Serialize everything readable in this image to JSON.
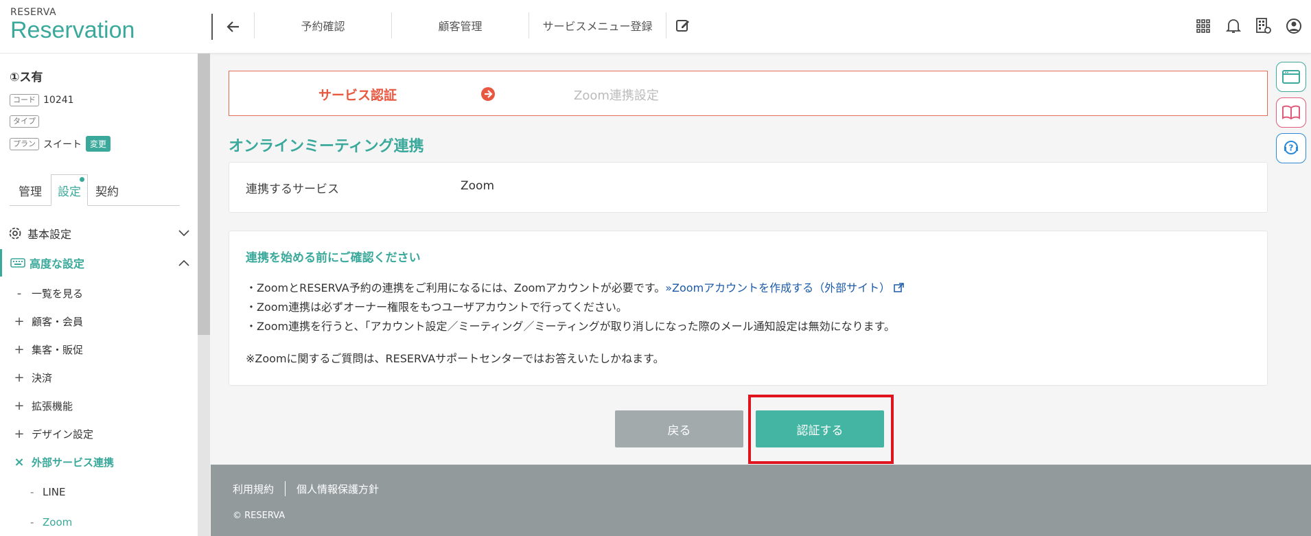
{
  "header": {
    "logo_small": "RESERVA",
    "logo_big": "Reservation",
    "nav": [
      "予約確認",
      "顧客管理",
      "サービスメニュー登録"
    ]
  },
  "sidebar": {
    "shop_name": "①ス有",
    "code_tag": "コード",
    "code_value": "10241",
    "type_tag": "タイプ",
    "plan_tag": "プラン",
    "plan_value": "スイート",
    "plan_change": "変更",
    "tabs": [
      "管理",
      "設定",
      "契約"
    ],
    "menu": [
      {
        "label": "基本設定"
      },
      {
        "label": "高度な設定"
      }
    ],
    "submenu": [
      {
        "sym": "-",
        "label": "一覧を見る"
      },
      {
        "sym": "+",
        "label": "顧客・会員"
      },
      {
        "sym": "+",
        "label": "集客・販促"
      },
      {
        "sym": "+",
        "label": "決済"
      },
      {
        "sym": "+",
        "label": "拡張機能"
      },
      {
        "sym": "+",
        "label": "デザイン設定"
      },
      {
        "sym": "×",
        "label": "外部サービス連携"
      }
    ],
    "subsub": [
      {
        "sym": "-",
        "label": "LINE"
      },
      {
        "sym": "-",
        "label": "Zoom"
      }
    ]
  },
  "steps": {
    "step1": "サービス認証",
    "step2": "Zoom連携設定"
  },
  "main": {
    "title": "オンラインミーティング連携",
    "service_key": "連携するサービス",
    "service_value": "Zoom",
    "notice_heading": "連携を始める前にご確認ください",
    "line1_text": "・ZoomとRESERVA予約の連携をご利用になるには、Zoomアカウントが必要です。",
    "line1_link": "»Zoomアカウントを作成する（外部サイト）",
    "line2": "・Zoom連携は必ずオーナー権限をもつユーザアカウントで行ってください。",
    "line3": "・Zoom連携を行うと、「アカウント設定／ミーティング／ミーティングが取り消しになった際のメール通知設定は無効になります。",
    "line4": "※Zoomに関するご質問は、RESERVAサポートセンターではお答えいたしかねます。",
    "back_button": "戻る",
    "auth_button": "認証する"
  },
  "footer": {
    "terms": "利用規約",
    "privacy": "個人情報保護方針",
    "copyright": "© RESERVA"
  },
  "colors": {
    "accent": "#3aa99b",
    "step_active": "#e8573f",
    "highlight": "#e0141e"
  }
}
